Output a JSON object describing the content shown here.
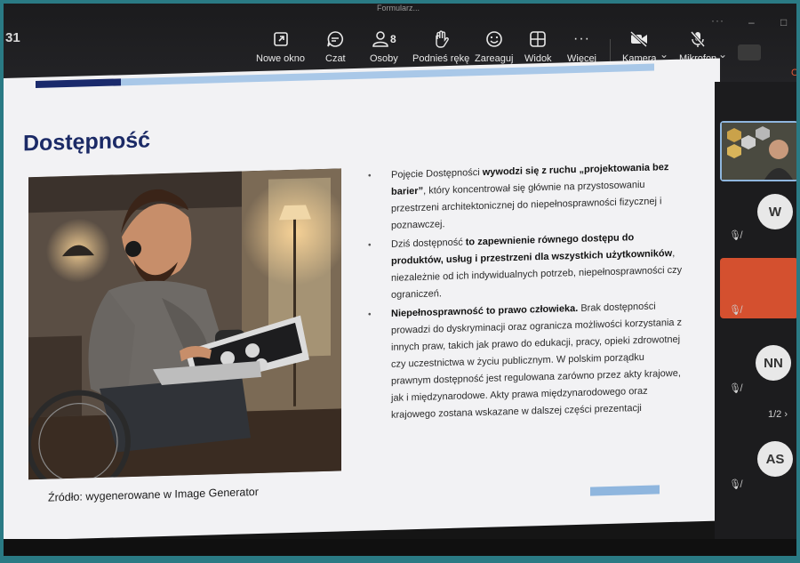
{
  "meeting": {
    "time": "31",
    "title": "Formularz...",
    "window_controls": [
      "...",
      "–",
      "□"
    ]
  },
  "toolbar": {
    "new_window": "Nowe okno",
    "chat": "Czat",
    "people": "Osoby",
    "people_count": "8",
    "raise_hand": "Podnieś rękę",
    "react": "Zareaguj",
    "view": "Widok",
    "more": "Więcej",
    "camera": "Kamera",
    "mic": "Mikrofon",
    "leave": "O"
  },
  "slide": {
    "title": "Dostępność",
    "source": "Źródło: wygenerowane w Image Generator",
    "bullets": [
      {
        "pre": "Pojęcie Dostępności ",
        "bold": "wywodzi się z ruchu „projektowania bez barier”",
        "post": ", który koncentrował się głównie na przystosowaniu przestrzeni architektonicznej do niepełnosprawności fizycznej i poznawczej."
      },
      {
        "pre": "Dziś dostępność ",
        "bold": "to zapewnienie równego dostępu do produktów, usług i przestrzeni dla wszystkich użytkowników",
        "post": ", niezależnie od ich indywidualnych potrzeb, niepełnosprawności czy ograniczeń."
      },
      {
        "pre": "",
        "bold": "Niepełnosprawność to prawo człowieka.",
        "post": " Brak dostępności prowadzi do dyskryminacji oraz ogranicza możliwości korzystania z innych praw, takich jak prawo do edukacji, pracy, opieki zdrowotnej czy uczestnictwa w życiu publicznym. W polskim porządku prawnym dostępność jest regulowana zarówno przez akty krajowe, jak i międzynarodowe. Akty prawa międzynarodowego oraz krajowego zostana wskazane w dalszej części prezentacji"
      }
    ]
  },
  "participants": {
    "initials": [
      "W",
      "NN",
      "AS"
    ],
    "pager": "1/2"
  },
  "colors": {
    "title_blue": "#1b2a66",
    "accent_dark": "#1a2a6c",
    "accent_light": "#a9c8e8",
    "speaker_tile": "#d4502f"
  }
}
